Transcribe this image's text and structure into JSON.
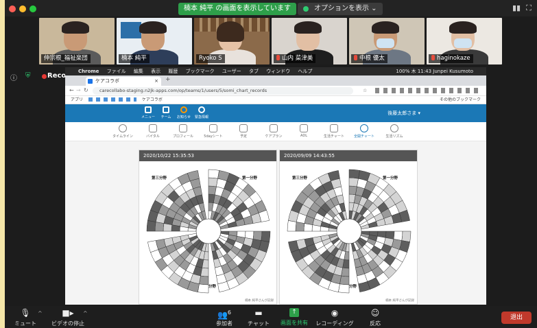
{
  "zoom": {
    "share_banner": "楠本 純平 の画面を表示しています",
    "view_options": "オプションを表示 ⌄",
    "recording": "Recording",
    "participants": [
      {
        "name": "仲宗根_福祉楽団"
      },
      {
        "name": "楠本 純平"
      },
      {
        "name": "Ryoko S"
      },
      {
        "name": "山内 菜津美"
      },
      {
        "name": "中根 優太"
      },
      {
        "name": "haginokaze"
      }
    ],
    "toolbar": {
      "mute": "ミュート",
      "video": "ビデオの停止",
      "participants": "参加者",
      "participants_count": "6",
      "chat": "チャット",
      "share": "画面を共有",
      "record": "レコーディング",
      "reactions": "反応",
      "leave": "退出"
    }
  },
  "browser": {
    "mac_menu": [
      "Chrome",
      "ファイル",
      "編集",
      "表示",
      "履歴",
      "ブックマーク",
      "ユーザー",
      "タブ",
      "ウィンドウ",
      "ヘルプ"
    ],
    "mac_status": "100% 木 11:43 Junpei Kusumoto",
    "tab_title": "ケアコラボ",
    "url": "carecollabo-staging.n2jk-apps.com/op/teams/1/users/5/somi_chart_records",
    "bookmarks": [
      "アプリ",
      "ケアコラボ"
    ],
    "other_bookmarks": "その他のブックマーク"
  },
  "app": {
    "nav": [
      "メニュー",
      "チーム",
      "お知らせ",
      "緊急情報"
    ],
    "user": "後藤太郎さま ▾",
    "subnav": [
      "タイムライン",
      "バイタル",
      "プロフィール",
      "5dayシート",
      "予定",
      "ケアプラン",
      "ADL",
      "生活チャート",
      "全開チャート",
      "生活リズム"
    ],
    "active_subnav": 8,
    "cards": [
      {
        "date": "2020/10/22 15:35:53",
        "quadrants": [
          "第三分野",
          "第一分野",
          "第二分野"
        ],
        "footer": "楠本 純平さんが記録"
      },
      {
        "date": "2020/09/09 14:43:55",
        "quadrants": [
          "第三分野",
          "第一分野",
          "第二分野"
        ],
        "footer": "楠本 純平さんが記録"
      }
    ]
  }
}
